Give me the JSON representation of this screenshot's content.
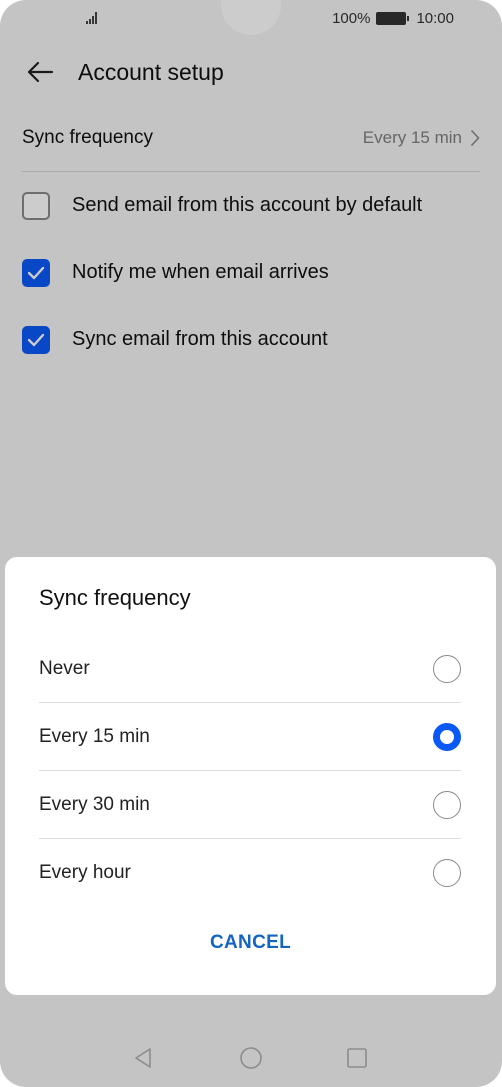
{
  "status_bar": {
    "battery_pct": "100%",
    "time": "10:00"
  },
  "header": {
    "title": "Account setup"
  },
  "settings": {
    "sync_label": "Sync frequency",
    "sync_value": "Every 15 min",
    "checkboxes": [
      {
        "label": "Send email from this account by default",
        "checked": false
      },
      {
        "label": "Notify me when email arrives",
        "checked": true
      },
      {
        "label": "Sync email from this account",
        "checked": true
      }
    ]
  },
  "dialog": {
    "title": "Sync frequency",
    "options": [
      {
        "label": "Never",
        "selected": false
      },
      {
        "label": "Every 15 min",
        "selected": true
      },
      {
        "label": "Every 30 min",
        "selected": false
      },
      {
        "label": "Every hour",
        "selected": false
      }
    ],
    "cancel_label": "CANCEL"
  },
  "colors": {
    "accent": "#0a59f7",
    "cancel": "#1565c0"
  }
}
